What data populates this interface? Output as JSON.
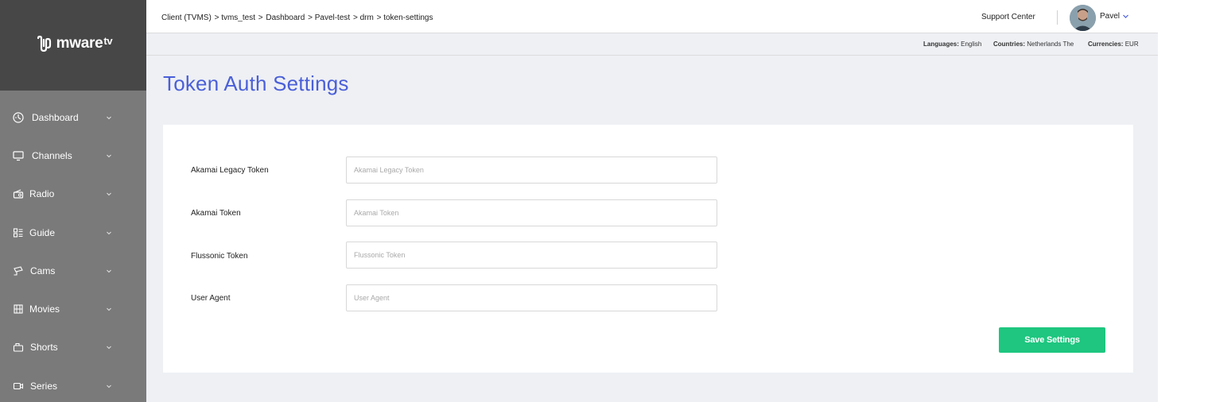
{
  "brand": {
    "name": "mware",
    "suffix": "tv"
  },
  "sidebar": {
    "items": [
      {
        "label": "Dashboard",
        "icon": "dashboard-icon"
      },
      {
        "label": "Channels",
        "icon": "monitor-icon"
      },
      {
        "label": "Radio",
        "icon": "radio-icon"
      },
      {
        "label": "Guide",
        "icon": "guide-grid-icon"
      },
      {
        "label": "Cams",
        "icon": "camera-icon"
      },
      {
        "label": "Movies",
        "icon": "film-icon"
      },
      {
        "label": "Shorts",
        "icon": "shorts-icon"
      },
      {
        "label": "Series",
        "icon": "video-icon"
      }
    ]
  },
  "header": {
    "breadcrumb": [
      "Client (TVMS)",
      "> tvms_test",
      ">",
      "Dashboard",
      "> Pavel-test",
      "> drm",
      "> token-settings"
    ],
    "support_label": "Support Center",
    "user_name": "Pavel"
  },
  "infobar": {
    "languages_label": "Languages:",
    "languages_value": "English",
    "countries_label": "Countries:",
    "countries_value": "Netherlands The",
    "currencies_label": "Currencies:",
    "currencies_value": "EUR"
  },
  "page": {
    "title": "Token Auth Settings"
  },
  "form": {
    "fields": [
      {
        "label": "Akamai Legacy Token",
        "placeholder": "Akamai Legacy Token",
        "value": ""
      },
      {
        "label": "Akamai Token",
        "placeholder": "Akamai Token",
        "value": ""
      },
      {
        "label": "Flussonic Token",
        "placeholder": "Flussonic Token",
        "value": ""
      },
      {
        "label": "User Agent",
        "placeholder": "User Agent",
        "value": ""
      }
    ],
    "save_label": "Save Settings"
  },
  "colors": {
    "sidebar_bg": "#7a7a7a",
    "logo_bg": "#474747",
    "title_color": "#4a5fd8",
    "save_button": "#1ec67f",
    "main_bg": "#eef0f4"
  }
}
